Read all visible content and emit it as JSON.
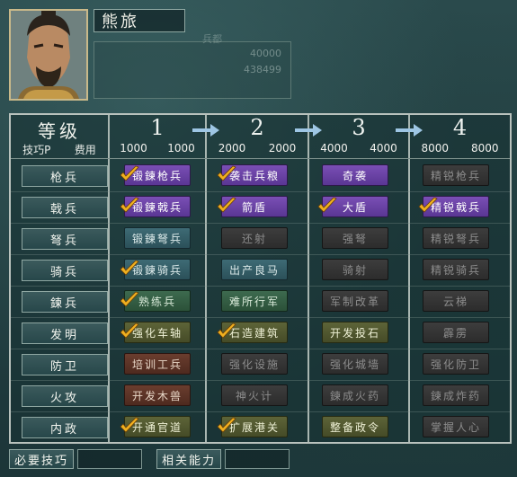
{
  "general": {
    "name": "熊旅",
    "stat_label": "兵都",
    "stat_value_1": "40000",
    "stat_value_2": "438499"
  },
  "header": {
    "level_label": "等级",
    "tech_label": "技巧P",
    "cost_label": "费用",
    "levels": [
      {
        "num": "1",
        "cost_a": "1000",
        "cost_b": "1000"
      },
      {
        "num": "2",
        "cost_a": "2000",
        "cost_b": "2000"
      },
      {
        "num": "3",
        "cost_a": "4000",
        "cost_b": "4000"
      },
      {
        "num": "4",
        "cost_a": "8000",
        "cost_b": "8000"
      }
    ]
  },
  "rows": [
    {
      "label": "枪兵",
      "cells": [
        {
          "text": "锻鍊枪兵",
          "color": "purple",
          "checked": true
        },
        {
          "text": "袭击兵粮",
          "color": "purple",
          "checked": true
        },
        {
          "text": "奇袭",
          "color": "purple",
          "checked": false
        },
        {
          "text": "精锐枪兵",
          "color": "gray",
          "checked": false
        }
      ]
    },
    {
      "label": "戟兵",
      "cells": [
        {
          "text": "锻鍊戟兵",
          "color": "purple",
          "checked": true
        },
        {
          "text": "箭盾",
          "color": "purple",
          "checked": true
        },
        {
          "text": "大盾",
          "color": "purple",
          "checked": true
        },
        {
          "text": "精锐戟兵",
          "color": "purple",
          "checked": true
        }
      ]
    },
    {
      "label": "弩兵",
      "cells": [
        {
          "text": "锻鍊弩兵",
          "color": "teal",
          "checked": false
        },
        {
          "text": "还射",
          "color": "gray",
          "checked": false
        },
        {
          "text": "强弩",
          "color": "gray",
          "checked": false
        },
        {
          "text": "精锐弩兵",
          "color": "gray",
          "checked": false
        }
      ]
    },
    {
      "label": "骑兵",
      "cells": [
        {
          "text": "锻鍊骑兵",
          "color": "teal",
          "checked": true
        },
        {
          "text": "出产良马",
          "color": "teal",
          "checked": false
        },
        {
          "text": "骑射",
          "color": "gray",
          "checked": false
        },
        {
          "text": "精锐骑兵",
          "color": "gray",
          "checked": false
        }
      ]
    },
    {
      "label": "鍊兵",
      "cells": [
        {
          "text": "熟练兵",
          "color": "green",
          "checked": true
        },
        {
          "text": "难所行军",
          "color": "green",
          "checked": false
        },
        {
          "text": "军制改革",
          "color": "gray",
          "checked": false
        },
        {
          "text": "云梯",
          "color": "gray",
          "checked": false
        }
      ]
    },
    {
      "label": "发明",
      "cells": [
        {
          "text": "强化车轴",
          "color": "olive",
          "checked": true
        },
        {
          "text": "石造建筑",
          "color": "olive",
          "checked": true
        },
        {
          "text": "开发投石",
          "color": "olive",
          "checked": false
        },
        {
          "text": "霹雳",
          "color": "gray",
          "checked": false
        }
      ]
    },
    {
      "label": "防卫",
      "cells": [
        {
          "text": "培训工兵",
          "color": "brown",
          "checked": false
        },
        {
          "text": "强化设施",
          "color": "gray",
          "checked": false
        },
        {
          "text": "强化城墙",
          "color": "gray",
          "checked": false
        },
        {
          "text": "强化防卫",
          "color": "gray",
          "checked": false
        }
      ]
    },
    {
      "label": "火攻",
      "cells": [
        {
          "text": "开发木兽",
          "color": "brown",
          "checked": false
        },
        {
          "text": "神火计",
          "color": "gray",
          "checked": false
        },
        {
          "text": "鍊成火药",
          "color": "gray",
          "checked": false
        },
        {
          "text": "鍊成炸药",
          "color": "gray",
          "checked": false
        }
      ]
    },
    {
      "label": "内政",
      "cells": [
        {
          "text": "开通官道",
          "color": "olive",
          "checked": true
        },
        {
          "text": "扩展港关",
          "color": "olive",
          "checked": true
        },
        {
          "text": "整备政令",
          "color": "olive",
          "checked": false
        },
        {
          "text": "掌握人心",
          "color": "gray",
          "checked": false
        }
      ]
    }
  ],
  "footer": {
    "required_label": "必要技巧",
    "related_label": "相关能力"
  }
}
